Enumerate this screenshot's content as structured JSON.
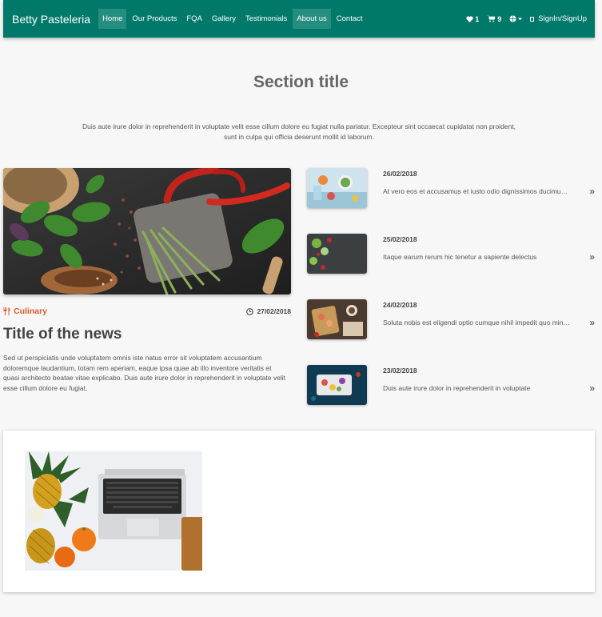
{
  "navbar": {
    "brand": "Betty Pasteleria",
    "links": [
      {
        "label": "Home",
        "active": true
      },
      {
        "label": "Our Products",
        "active": false
      },
      {
        "label": "FQA",
        "active": false
      },
      {
        "label": "Gallery",
        "active": false
      },
      {
        "label": "Testimonials",
        "active": false
      },
      {
        "label": "About us",
        "active": true
      },
      {
        "label": "Contact",
        "active": false
      }
    ],
    "wishlist_count": "1",
    "cart_count": "9",
    "signin_label": "SignIn/SignUp",
    "color": "#00796b"
  },
  "section": {
    "title": "Section title",
    "description": "Duis aute irure dolor in reprehenderit in voluptate velit esse cillum dolore eu fugiat nulla pariatur. Excepteur sint occaecat cupidatat non proident, sunt in culpa qui officia deserunt mollit id laborum."
  },
  "featured": {
    "category": "Culinary",
    "date": "27/02/2018",
    "title": "Title of the news",
    "body": "Sed ut perspiciatis unde voluptatem omnis iste natus error sit voluptatem accusantium doloremque laudantium, totam rem aperiam, eaque ipsa quae ab illo inventore veritatis et quasi architecto beatae vitae explicabo. Duis aute irure dolor in reprehenderit in voluptate velit esse cillum dolore eu fugiat.",
    "accent_color": "#e05a2b"
  },
  "side_news": [
    {
      "date": "26/02/2018",
      "text": "At vero eos et accusamus et iusto odio dignissimos ducimus qui blanditiis"
    },
    {
      "date": "25/02/2018",
      "text": "Itaque earum rerum hic tenetur a sapiente delectus"
    },
    {
      "date": "24/02/2018",
      "text": "Soluta nobis est eligendi optio cumque nihil impedit quo minus id quod"
    },
    {
      "date": "23/02/2018",
      "text": "Duis aute irure dolor in reprehenderit in voluptate"
    }
  ],
  "icons": {
    "wishlist": "heart-icon",
    "cart": "cart-icon",
    "language": "globe-icon",
    "category": "fork-knife-icon",
    "date": "clock-icon",
    "more": "double-chevron-right-icon"
  }
}
